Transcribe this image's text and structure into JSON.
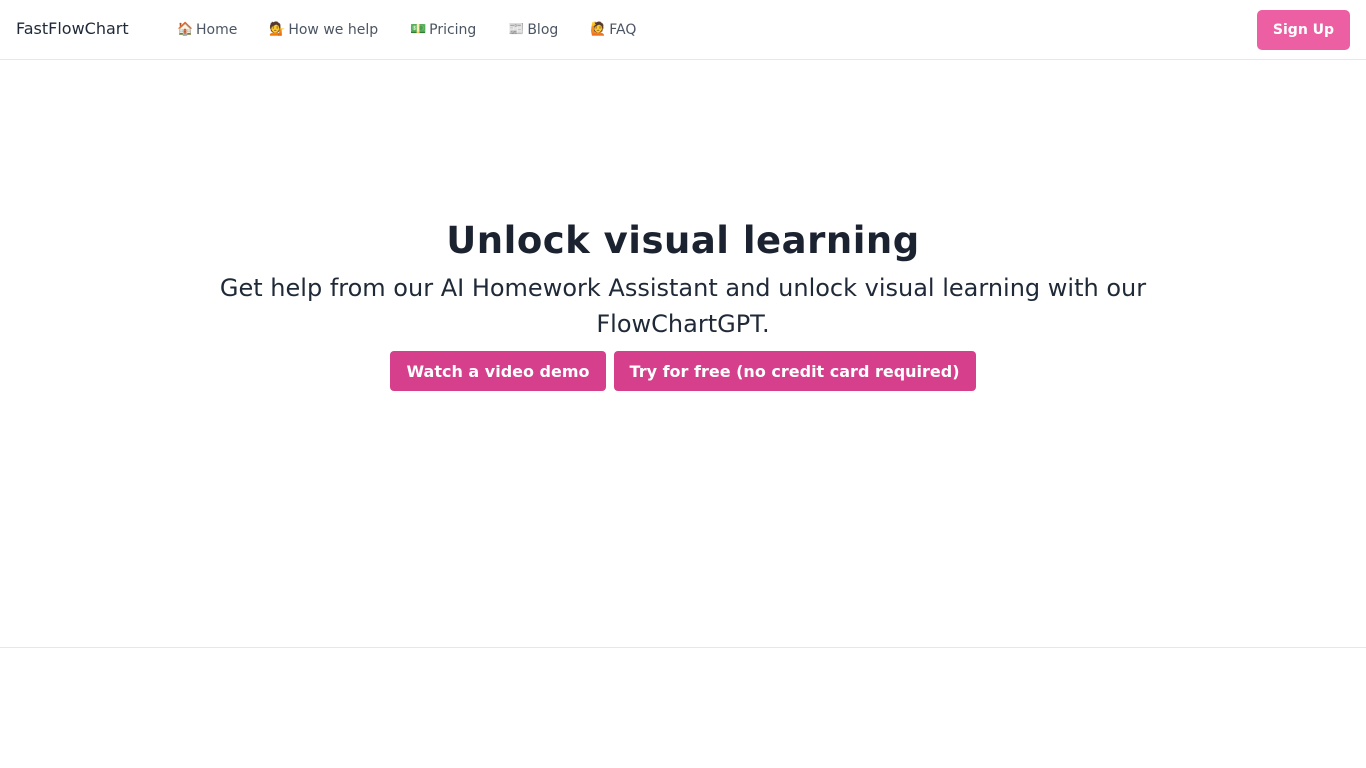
{
  "navbar": {
    "brand": "FastFlowChart",
    "links": [
      {
        "icon": "🏠",
        "icon_name": "house-icon",
        "label": "Home"
      },
      {
        "icon": "💁",
        "icon_name": "person-tipping-hand-icon",
        "label": "How we help"
      },
      {
        "icon": "💵",
        "icon_name": "dollar-banknote-icon",
        "label": "Pricing"
      },
      {
        "icon": "📰",
        "icon_name": "newspaper-icon",
        "label": "Blog"
      },
      {
        "icon": "🙋",
        "icon_name": "person-raising-hand-icon",
        "label": "FAQ"
      }
    ],
    "signup_label": "Sign Up"
  },
  "hero": {
    "title": "Unlock visual learning",
    "subtitle": "Get help from our AI Homework Assistant and unlock visual learning with our FlowChartGPT.",
    "demo_button": "Watch a video demo",
    "trial_button": "Try for free (no credit card required)"
  },
  "colors": {
    "signup_bg": "#ec5fa3",
    "cta_bg": "#d63f8c",
    "heading": "#1b2230",
    "nav_text": "#4b5563"
  }
}
